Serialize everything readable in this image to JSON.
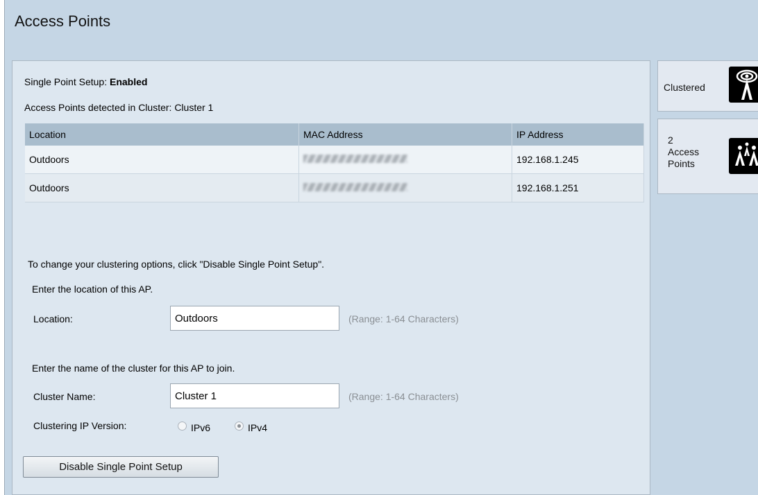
{
  "page": {
    "title": "Access Points"
  },
  "status": {
    "single_point_label": "Single Point Setup:",
    "single_point_value": "Enabled",
    "detected_text": "Access Points detected in Cluster: Cluster 1"
  },
  "table": {
    "columns": [
      "Location",
      "MAC Address",
      "IP Address"
    ],
    "rows": [
      {
        "location": "Outdoors",
        "mac": "",
        "ip": "192.168.1.245"
      },
      {
        "location": "Outdoors",
        "mac": "",
        "ip": "192.168.1.251"
      }
    ]
  },
  "form": {
    "instructions": "To change your clustering options, click \"Disable Single Point Setup\".",
    "location_prompt": "Enter the location of this AP.",
    "location_label": "Location:",
    "location_value": "Outdoors",
    "location_hint": "(Range: 1-64 Characters)",
    "cluster_prompt": "Enter the name of the cluster for this AP to join.",
    "cluster_label": "Cluster Name:",
    "cluster_value": "Cluster 1",
    "cluster_hint": "(Range: 1-64 Characters)",
    "ip_version_label": "Clustering IP Version:",
    "ip_options": [
      "IPv6",
      "IPv4"
    ],
    "ip_selected": "IPv4",
    "disable_button": "Disable Single Point Setup"
  },
  "sidebar": {
    "clustered_label": "Clustered",
    "clustered_icon": "wireless-tower-icon",
    "ap_count": "2",
    "ap_label_line1": "Access",
    "ap_label_line2": "Points",
    "ap_icon": "access-points-icon"
  }
}
